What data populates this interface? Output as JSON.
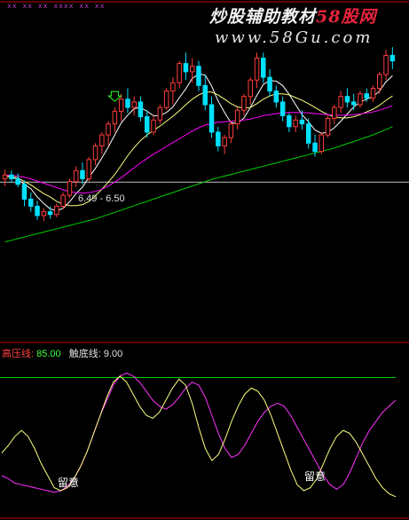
{
  "watermark": {
    "brand": "炒股辅助教材",
    "site": "58股网",
    "url": "www.58Gu.com"
  },
  "top_marker_text": "xx  xx  xx   xxxx  xx   xx",
  "price_range_label": "6.49 - 6.50",
  "indicator": {
    "upper_label": "高压线:",
    "upper_value": "85.00",
    "lower_label": "触底线:",
    "lower_value": "9.00"
  },
  "annotations": [
    {
      "text": "留意"
    },
    {
      "text": "留意"
    }
  ],
  "colors": {
    "up": "#ff3c3c",
    "down": "#00e0ff",
    "ma_short": "#ffffff",
    "ma_mid": "#ffff80",
    "ma_long1": "#ff00ff",
    "ma_long2": "#00d000",
    "separator": "#c00000",
    "upper_line": "#00d000",
    "osc_pink": "#ff33ff",
    "osc_yellow": "#ffff80",
    "upper_label": "#ff4040",
    "upper_value": "#40ff40",
    "lower_text": "#e0e0e0"
  },
  "chart_data": [
    {
      "type": "candlestick",
      "title": "",
      "ylim": [
        5.2,
        9.0
      ],
      "candles": [
        {
          "o": 6.55,
          "h": 6.72,
          "l": 6.42,
          "c": 6.62
        },
        {
          "o": 6.62,
          "h": 6.7,
          "l": 6.48,
          "c": 6.55
        },
        {
          "o": 6.55,
          "h": 6.65,
          "l": 6.4,
          "c": 6.45
        },
        {
          "o": 6.45,
          "h": 6.52,
          "l": 6.05,
          "c": 6.18
        },
        {
          "o": 6.18,
          "h": 6.3,
          "l": 5.95,
          "c": 6.05
        },
        {
          "o": 6.05,
          "h": 6.15,
          "l": 5.8,
          "c": 5.88
        },
        {
          "o": 5.88,
          "h": 6.02,
          "l": 5.78,
          "c": 5.95
        },
        {
          "o": 5.95,
          "h": 6.05,
          "l": 5.82,
          "c": 5.9
        },
        {
          "o": 5.9,
          "h": 6.1,
          "l": 5.85,
          "c": 6.05
        },
        {
          "o": 6.05,
          "h": 6.3,
          "l": 6.0,
          "c": 6.25
        },
        {
          "o": 6.25,
          "h": 6.55,
          "l": 6.2,
          "c": 6.5
        },
        {
          "o": 6.5,
          "h": 6.78,
          "l": 6.4,
          "c": 6.7
        },
        {
          "o": 6.7,
          "h": 6.85,
          "l": 6.45,
          "c": 6.55
        },
        {
          "o": 6.55,
          "h": 6.95,
          "l": 6.5,
          "c": 6.9
        },
        {
          "o": 6.9,
          "h": 7.2,
          "l": 6.8,
          "c": 7.15
        },
        {
          "o": 7.15,
          "h": 7.4,
          "l": 7.0,
          "c": 7.35
        },
        {
          "o": 7.35,
          "h": 7.6,
          "l": 7.15,
          "c": 7.55
        },
        {
          "o": 7.55,
          "h": 7.85,
          "l": 7.4,
          "c": 7.78
        },
        {
          "o": 7.78,
          "h": 8.1,
          "l": 7.6,
          "c": 8.0
        },
        {
          "o": 8.0,
          "h": 8.2,
          "l": 7.75,
          "c": 7.85
        },
        {
          "o": 7.85,
          "h": 8.05,
          "l": 7.7,
          "c": 7.95
        },
        {
          "o": 7.95,
          "h": 8.05,
          "l": 7.6,
          "c": 7.68
        },
        {
          "o": 7.68,
          "h": 7.8,
          "l": 7.3,
          "c": 7.4
        },
        {
          "o": 7.4,
          "h": 7.7,
          "l": 7.35,
          "c": 7.62
        },
        {
          "o": 7.62,
          "h": 7.9,
          "l": 7.55,
          "c": 7.85
        },
        {
          "o": 7.85,
          "h": 8.2,
          "l": 7.8,
          "c": 8.15
        },
        {
          "o": 8.15,
          "h": 8.4,
          "l": 7.9,
          "c": 8.3
        },
        {
          "o": 8.3,
          "h": 8.7,
          "l": 8.2,
          "c": 8.65
        },
        {
          "o": 8.65,
          "h": 8.85,
          "l": 8.35,
          "c": 8.5
        },
        {
          "o": 8.5,
          "h": 8.75,
          "l": 8.3,
          "c": 8.6
        },
        {
          "o": 8.6,
          "h": 8.7,
          "l": 8.15,
          "c": 8.25
        },
        {
          "o": 8.25,
          "h": 8.45,
          "l": 7.8,
          "c": 7.9
        },
        {
          "o": 7.9,
          "h": 8.05,
          "l": 7.3,
          "c": 7.4
        },
        {
          "o": 7.4,
          "h": 7.5,
          "l": 7.05,
          "c": 7.15
        },
        {
          "o": 7.15,
          "h": 7.35,
          "l": 7.0,
          "c": 7.3
        },
        {
          "o": 7.3,
          "h": 7.6,
          "l": 7.2,
          "c": 7.55
        },
        {
          "o": 7.55,
          "h": 7.85,
          "l": 7.45,
          "c": 7.8
        },
        {
          "o": 7.8,
          "h": 8.1,
          "l": 7.7,
          "c": 8.05
        },
        {
          "o": 8.05,
          "h": 8.4,
          "l": 7.9,
          "c": 8.35
        },
        {
          "o": 8.35,
          "h": 8.85,
          "l": 8.2,
          "c": 8.75
        },
        {
          "o": 8.75,
          "h": 8.85,
          "l": 8.3,
          "c": 8.4
        },
        {
          "o": 8.4,
          "h": 8.55,
          "l": 8.05,
          "c": 8.15
        },
        {
          "o": 8.15,
          "h": 8.25,
          "l": 7.85,
          "c": 7.95
        },
        {
          "o": 7.95,
          "h": 8.05,
          "l": 7.6,
          "c": 7.7
        },
        {
          "o": 7.7,
          "h": 7.75,
          "l": 7.4,
          "c": 7.5
        },
        {
          "o": 7.5,
          "h": 7.7,
          "l": 7.4,
          "c": 7.62
        },
        {
          "o": 7.62,
          "h": 7.8,
          "l": 7.45,
          "c": 7.55
        },
        {
          "o": 7.55,
          "h": 7.65,
          "l": 7.1,
          "c": 7.2
        },
        {
          "o": 7.2,
          "h": 7.35,
          "l": 6.95,
          "c": 7.05
        },
        {
          "o": 7.05,
          "h": 7.4,
          "l": 7.0,
          "c": 7.35
        },
        {
          "o": 7.35,
          "h": 7.7,
          "l": 7.3,
          "c": 7.65
        },
        {
          "o": 7.65,
          "h": 7.9,
          "l": 7.55,
          "c": 7.85
        },
        {
          "o": 7.85,
          "h": 8.15,
          "l": 7.75,
          "c": 8.05
        },
        {
          "o": 8.05,
          "h": 8.2,
          "l": 7.85,
          "c": 7.95
        },
        {
          "o": 7.95,
          "h": 8.1,
          "l": 7.8,
          "c": 7.9
        },
        {
          "o": 7.9,
          "h": 8.15,
          "l": 7.85,
          "c": 8.1
        },
        {
          "o": 8.1,
          "h": 8.2,
          "l": 7.95,
          "c": 8.02
        },
        {
          "o": 8.02,
          "h": 8.25,
          "l": 7.95,
          "c": 8.2
        },
        {
          "o": 8.2,
          "h": 8.5,
          "l": 8.1,
          "c": 8.45
        },
        {
          "o": 8.45,
          "h": 8.9,
          "l": 8.35,
          "c": 8.8
        },
        {
          "o": 8.8,
          "h": 8.95,
          "l": 8.55,
          "c": 8.7
        }
      ],
      "series": [
        {
          "values": [
            6.6,
            6.58,
            6.54,
            6.45,
            6.37,
            6.22,
            6.1,
            6.0,
            5.97,
            6.01,
            6.13,
            6.28,
            6.4,
            6.58,
            6.74,
            6.93,
            7.13,
            7.35,
            7.57,
            7.71,
            7.83,
            7.85,
            7.78,
            7.7,
            7.7,
            7.76,
            7.86,
            8.03,
            8.19,
            8.38,
            8.46,
            8.44,
            8.24,
            7.97,
            7.76,
            7.57,
            7.56,
            7.66,
            7.85,
            8.07,
            8.27,
            8.34,
            8.33,
            8.25,
            8.09,
            7.9,
            7.72,
            7.59,
            7.44,
            7.38,
            7.4,
            7.48,
            7.6,
            7.73,
            7.86,
            7.95,
            8.0,
            8.05,
            8.15,
            8.32,
            8.43
          ]
        },
        {
          "values": [
            6.6,
            6.59,
            6.57,
            6.5,
            6.44,
            6.36,
            6.28,
            6.22,
            6.14,
            6.09,
            6.06,
            6.06,
            6.08,
            6.14,
            6.24,
            6.36,
            6.49,
            6.63,
            6.8,
            6.97,
            7.12,
            7.25,
            7.35,
            7.43,
            7.51,
            7.6,
            7.69,
            7.79,
            7.9,
            8.0,
            8.08,
            8.13,
            8.13,
            8.08,
            8.0,
            7.92,
            7.86,
            7.84,
            7.85,
            7.92,
            8.0,
            8.06,
            8.1,
            8.1,
            8.08,
            8.03,
            7.98,
            7.92,
            7.85,
            7.78,
            7.72,
            7.68,
            7.66,
            7.66,
            7.68,
            7.72,
            7.77,
            7.82,
            7.89,
            7.98,
            8.06
          ]
        },
        {
          "values": [
            6.62,
            6.61,
            6.6,
            6.58,
            6.55,
            6.51,
            6.47,
            6.43,
            6.39,
            6.35,
            6.32,
            6.3,
            6.29,
            6.3,
            6.32,
            6.36,
            6.42,
            6.49,
            6.57,
            6.66,
            6.75,
            6.84,
            6.92,
            7.0,
            7.07,
            7.14,
            7.21,
            7.28,
            7.35,
            7.42,
            7.48,
            7.53,
            7.56,
            7.58,
            7.59,
            7.6,
            7.61,
            7.62,
            7.64,
            7.67,
            7.7,
            7.72,
            7.74,
            7.75,
            7.76,
            7.76,
            7.76,
            7.75,
            7.74,
            7.73,
            7.72,
            7.71,
            7.71,
            7.71,
            7.72,
            7.73,
            7.75,
            7.77,
            7.8,
            7.84,
            7.88
          ]
        },
        {
          "values": [
            5.4,
            5.43,
            5.46,
            5.49,
            5.52,
            5.55,
            5.58,
            5.61,
            5.64,
            5.67,
            5.7,
            5.73,
            5.76,
            5.79,
            5.82,
            5.86,
            5.9,
            5.94,
            5.98,
            6.02,
            6.06,
            6.1,
            6.14,
            6.18,
            6.22,
            6.26,
            6.3,
            6.34,
            6.38,
            6.42,
            6.46,
            6.5,
            6.54,
            6.57,
            6.6,
            6.63,
            6.66,
            6.69,
            6.72,
            6.75,
            6.78,
            6.81,
            6.84,
            6.87,
            6.9,
            6.93,
            6.96,
            6.99,
            7.02,
            7.05,
            7.08,
            7.11,
            7.15,
            7.19,
            7.23,
            7.27,
            7.31,
            7.35,
            7.4,
            7.45,
            7.5
          ]
        }
      ],
      "hline": 6.49
    },
    {
      "type": "line",
      "title": "",
      "ylim": [
        0,
        100
      ],
      "hlines": [
        85,
        9
      ],
      "series": [
        {
          "values": [
            20,
            18,
            15,
            14,
            13,
            12,
            11,
            10,
            9,
            10,
            13,
            18,
            26,
            36,
            48,
            60,
            70,
            80,
            86,
            88,
            86,
            82,
            76,
            70,
            66,
            64,
            67,
            72,
            78,
            82,
            80,
            72,
            60,
            48,
            38,
            32,
            34,
            40,
            48,
            56,
            62,
            66,
            68,
            66,
            60,
            52,
            44,
            36,
            28,
            20,
            14,
            11,
            14,
            22,
            32,
            42,
            50,
            56,
            62,
            66,
            70
          ]
        },
        {
          "values": [
            35,
            40,
            46,
            50,
            46,
            38,
            28,
            20,
            12,
            10,
            12,
            18,
            26,
            36,
            48,
            60,
            72,
            82,
            86,
            82,
            74,
            66,
            60,
            58,
            62,
            70,
            78,
            84,
            80,
            68,
            52,
            38,
            30,
            34,
            44,
            56,
            66,
            74,
            78,
            76,
            70,
            60,
            48,
            36,
            24,
            14,
            10,
            12,
            18,
            28,
            38,
            46,
            50,
            48,
            42,
            34,
            26,
            18,
            12,
            8,
            6
          ]
        }
      ]
    }
  ]
}
